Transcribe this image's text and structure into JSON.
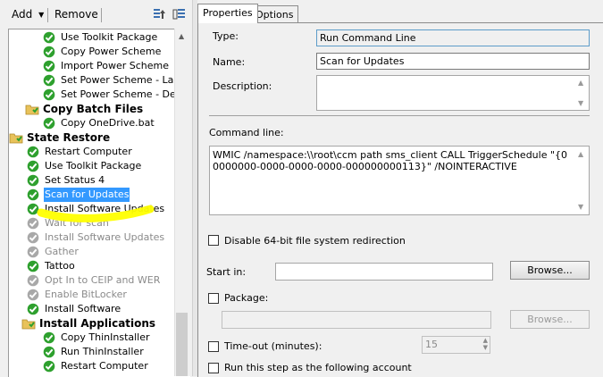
{
  "toolbar": {
    "add_label": "Add",
    "remove_label": "Remove"
  },
  "tree": {
    "items": [
      {
        "label": "Use Toolkit Package",
        "state": "ok"
      },
      {
        "label": "Copy Power Scheme",
        "state": "ok"
      },
      {
        "label": "Import Power Scheme",
        "state": "ok"
      },
      {
        "label": "Set Power Scheme - Laptop",
        "state": "ok"
      },
      {
        "label": "Set Power Scheme - Desktop",
        "state": "ok"
      },
      {
        "label": "Copy Batch Files",
        "state": "folder"
      },
      {
        "label": "Copy OneDrive.bat",
        "state": "ok"
      },
      {
        "label": "State Restore",
        "state": "folder"
      },
      {
        "label": "Restart Computer",
        "state": "ok"
      },
      {
        "label": "Use Toolkit Package",
        "state": "ok"
      },
      {
        "label": "Set Status 4",
        "state": "ok"
      },
      {
        "label": "Scan for Updates",
        "state": "ok"
      },
      {
        "label": "Install Software Updates",
        "state": "ok"
      },
      {
        "label": "Wait for scan",
        "state": "disabled"
      },
      {
        "label": "Install Software Updates",
        "state": "disabled"
      },
      {
        "label": "Gather",
        "state": "disabled"
      },
      {
        "label": "Tattoo",
        "state": "ok"
      },
      {
        "label": "Opt In to CEIP and WER",
        "state": "disabled"
      },
      {
        "label": "Enable BitLocker",
        "state": "disabled"
      },
      {
        "label": "Install Software",
        "state": "ok"
      },
      {
        "label": "Install Applications",
        "state": "folder"
      },
      {
        "label": "Copy ThinInstaller",
        "state": "ok"
      },
      {
        "label": "Run ThinInstaller",
        "state": "ok"
      },
      {
        "label": "Restart Computer",
        "state": "ok"
      }
    ]
  },
  "tabs": {
    "properties": "Properties",
    "options": "Options"
  },
  "form": {
    "type_label": "Type:",
    "type_value": "Run Command Line",
    "name_label": "Name:",
    "name_value": "Scan for Updates",
    "description_label": "Description:",
    "description_value": "",
    "command_label": "Command line:",
    "command_value": "WMIC /namespace:\\\\root\\ccm path sms_client CALL TriggerSchedule \"{00000000-0000-0000-0000-000000000113}\" /NOINTERACTIVE",
    "disable64_label": "Disable 64-bit file system redirection",
    "startin_label": "Start in:",
    "startin_value": "",
    "browse_label": "Browse...",
    "package_label": "Package:",
    "package_value": "",
    "browse2_label": "Browse...",
    "timeout_label": "Time-out (minutes):",
    "timeout_value": "15",
    "runas_label": "Run this step as the following account"
  },
  "colors": {
    "selection": "#3399ff",
    "highlighter": "#ffff00",
    "check_green": "#2ea02e",
    "folder": "#e8c25a"
  }
}
